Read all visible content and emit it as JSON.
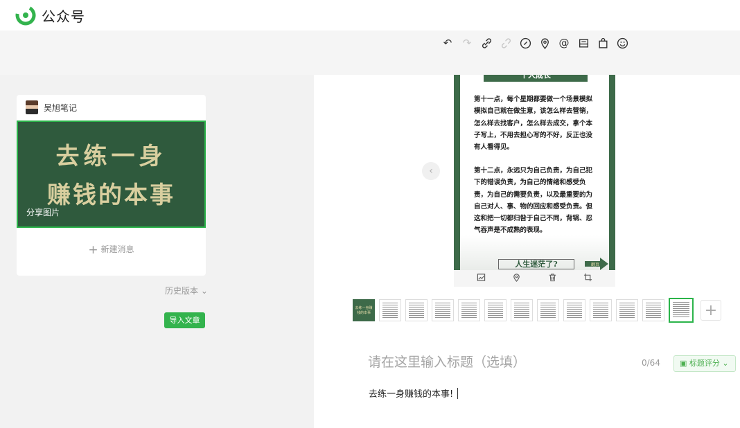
{
  "app": {
    "title": "公众号",
    "brand_color": "#33b34d"
  },
  "toolbar": {
    "icons": [
      "undo-icon",
      "redo-icon",
      "link-icon",
      "unlink-icon",
      "attachment-link-icon",
      "location-icon",
      "mention-icon",
      "product-icon",
      "shopping-bag-icon",
      "emoji-icon"
    ]
  },
  "left_panel": {
    "account_name": "吴旭笔记",
    "cover": {
      "line1": "去练一身",
      "line2": "赚钱的本事",
      "label": "分享图片",
      "bg_color": "#2f5a3d"
    },
    "new_message": "新建消息",
    "history": "历史版本",
    "import_button": "导入文章"
  },
  "image_preview": {
    "header": "个人成长",
    "paragraph1": "第十一点，每个星期都要做一个场景模拟模拟自己就在做生意，该怎么样去营销，怎么样去找客户，怎么样去成交，拿个本子写上，不用去担心写的不好，反正也没有人看得见。",
    "paragraph2": "第十二点，永远只为自己负责，为自己犯下的错误负责，为自己的情绪和感受负责，为自己的需要负责，以及最重要的为自己对人、事、物的回应和感受负责。但这和把一切都归咎于自己不同，背锅、忍气吞声是不成熟的表现。",
    "footer_box": "人生迷茫了?",
    "footer_arrow": "翻页"
  },
  "thumbnails": {
    "first_label": "去练一身赚钱的本事"
  },
  "editor": {
    "title_placeholder": "请在这里输入标题（选填）",
    "counter": "0/64",
    "score_button": "标题评分",
    "body_text": "去练一身赚钱的本事!"
  }
}
